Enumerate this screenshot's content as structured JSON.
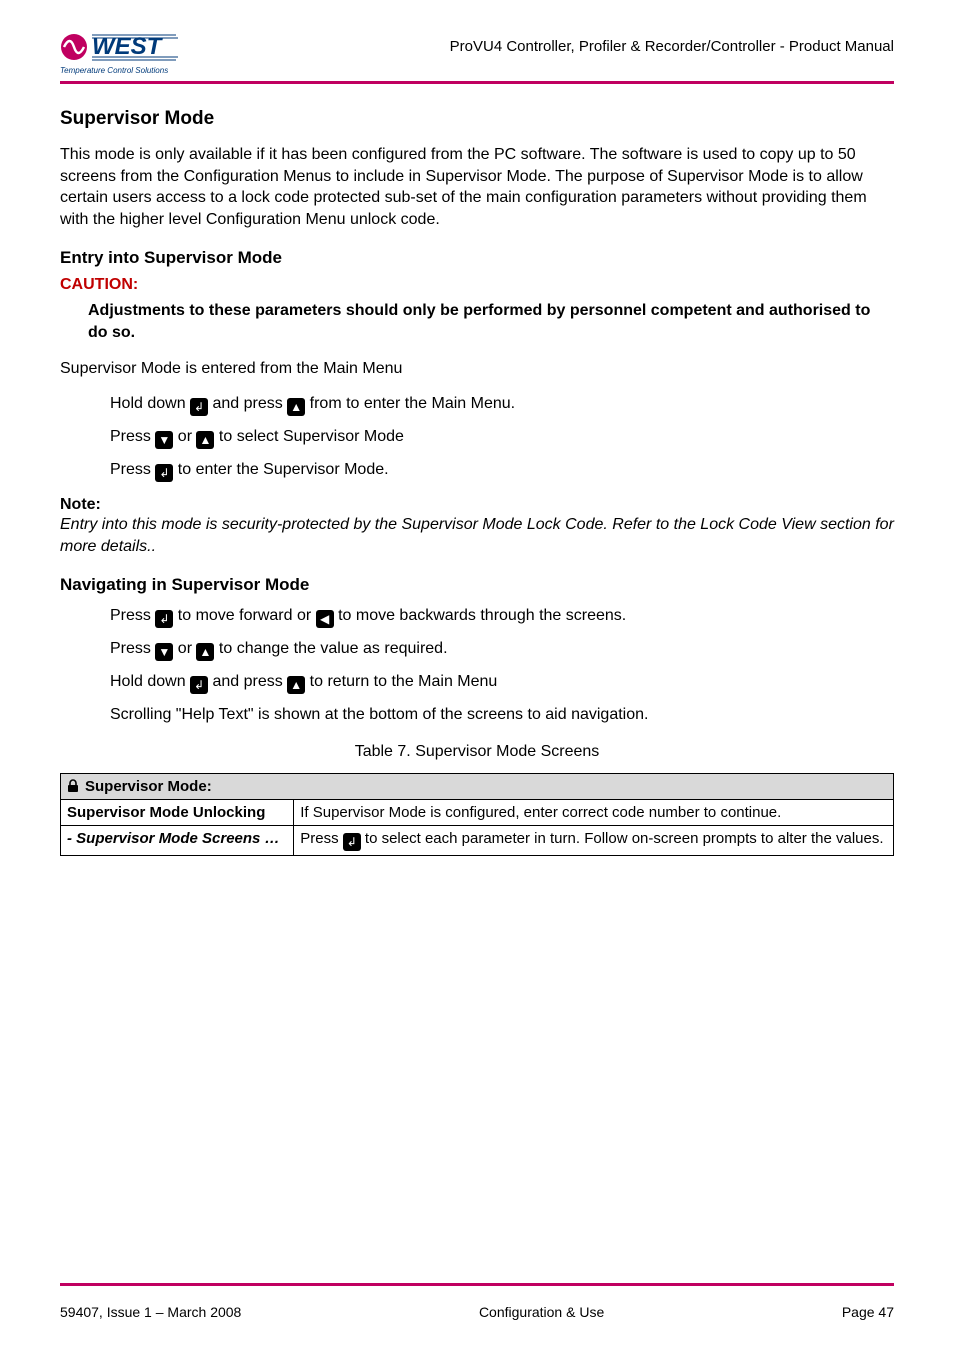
{
  "header": {
    "logo_text": "WEST",
    "tagline": "Temperature Control Solutions",
    "doc_title": "ProVU4 Controller, Profiler & Recorder/Controller - Product Manual"
  },
  "section": {
    "title": "Supervisor Mode",
    "intro": "This mode is only available if it has been configured from the PC software. The software is used to copy up to 50 screens from the Configuration Menus to include in Supervisor Mode. The purpose of Supervisor Mode is to allow certain users access to a lock code protected sub-set of the main configuration parameters without providing them with the higher level Configuration Menu unlock code."
  },
  "entry": {
    "heading": "Entry into Supervisor Mode",
    "caution_label": "CAUTION:",
    "caution_body": "Adjustments to these parameters should only be performed by personnel competent and authorised to do so.",
    "line_before_steps": "Supervisor Mode is entered from the Main Menu",
    "steps": {
      "s1a": "Hold down ",
      "s1b": " and press ",
      "s1c": " from to enter the Main Menu.",
      "s2a": "Press ",
      "s2b": " or ",
      "s2c": "  to select Supervisor Mode",
      "s3a": "Press ",
      "s3b": "  to enter the Supervisor Mode."
    },
    "note_label": "Note:",
    "note_body": "Entry into this mode is security-protected by the Supervisor Mode Lock Code. Refer to the Lock Code View section for more details."
  },
  "navigating": {
    "heading": "Navigating in Supervisor Mode",
    "steps": {
      "n1a": "Press ",
      "n1b": "  to move forward or ",
      "n1c": "  to move backwards through the screens.",
      "n2a": "Press ",
      "n2b": " or ",
      "n2c": "  to change the value as required.",
      "n3a": "Hold down ",
      "n3b": " and press ",
      "n3c": " to return to the Main Menu",
      "n4": "Scrolling \"Help Text\" is shown at the bottom of the screens to aid navigation."
    }
  },
  "table": {
    "caption": "Table 7.   Supervisor Mode Screens",
    "header": "Supervisor Mode:",
    "rows": [
      {
        "label": "Supervisor Mode Unlocking",
        "italic": false,
        "desc_a": "If Supervisor Mode is configured, enter correct code number to continue.",
        "has_icon": false
      },
      {
        "label": " - Supervisor Mode Screens …",
        "italic": true,
        "desc_a": "Press ",
        "desc_b": "  to select each parameter in turn. Follow on-screen prompts to alter the values.",
        "has_icon": true
      }
    ]
  },
  "footer": {
    "left": "59407, Issue 1 – March 2008",
    "center": "Configuration & Use",
    "right": "Page 47"
  },
  "icons": {
    "enter": "↲",
    "up": "▲",
    "down": "▼",
    "left": "◀"
  }
}
